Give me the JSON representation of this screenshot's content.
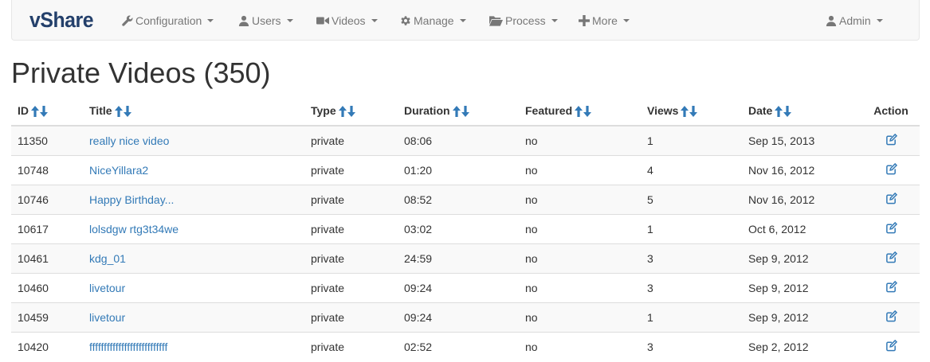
{
  "nav": {
    "brand": "vShare",
    "items": [
      {
        "label": "Configuration",
        "icon": "wrench-icon"
      },
      {
        "label": "Users",
        "icon": "user-icon"
      },
      {
        "label": "Videos",
        "icon": "video-camera-icon"
      },
      {
        "label": "Manage",
        "icon": "gear-icon"
      },
      {
        "label": "Process",
        "icon": "folder-open-icon"
      },
      {
        "label": "More",
        "icon": "plus-icon"
      }
    ],
    "user": {
      "label": "Admin",
      "icon": "user-icon"
    }
  },
  "page": {
    "title": "Private Videos (350)"
  },
  "table": {
    "columns": [
      "ID",
      "Title",
      "Type",
      "Duration",
      "Featured",
      "Views",
      "Date",
      "Action"
    ],
    "rows": [
      {
        "id": "11350",
        "title": "really nice video",
        "type": "private",
        "duration": "08:06",
        "featured": "no",
        "views": "1",
        "date": "Sep 15, 2013"
      },
      {
        "id": "10748",
        "title": "NiceYillara2",
        "type": "private",
        "duration": "01:20",
        "featured": "no",
        "views": "4",
        "date": "Nov 16, 2012"
      },
      {
        "id": "10746",
        "title": "Happy Birthday...",
        "type": "private",
        "duration": "08:52",
        "featured": "no",
        "views": "5",
        "date": "Nov 16, 2012"
      },
      {
        "id": "10617",
        "title": "lolsdgw rtg3t34we",
        "type": "private",
        "duration": "03:02",
        "featured": "no",
        "views": "1",
        "date": "Oct 6, 2012"
      },
      {
        "id": "10461",
        "title": "kdg_01",
        "type": "private",
        "duration": "24:59",
        "featured": "no",
        "views": "3",
        "date": "Sep 9, 2012"
      },
      {
        "id": "10460",
        "title": "livetour",
        "type": "private",
        "duration": "09:24",
        "featured": "no",
        "views": "3",
        "date": "Sep 9, 2012"
      },
      {
        "id": "10459",
        "title": "livetour",
        "type": "private",
        "duration": "09:24",
        "featured": "no",
        "views": "1",
        "date": "Sep 9, 2012"
      },
      {
        "id": "10420",
        "title": "fffffffffffffffffffffffffff",
        "type": "private",
        "duration": "02:52",
        "featured": "no",
        "views": "3",
        "date": "Sep 2, 2012"
      }
    ]
  },
  "colors": {
    "brand": "#24406b",
    "link": "#337ab7",
    "nav_text": "#777777"
  }
}
